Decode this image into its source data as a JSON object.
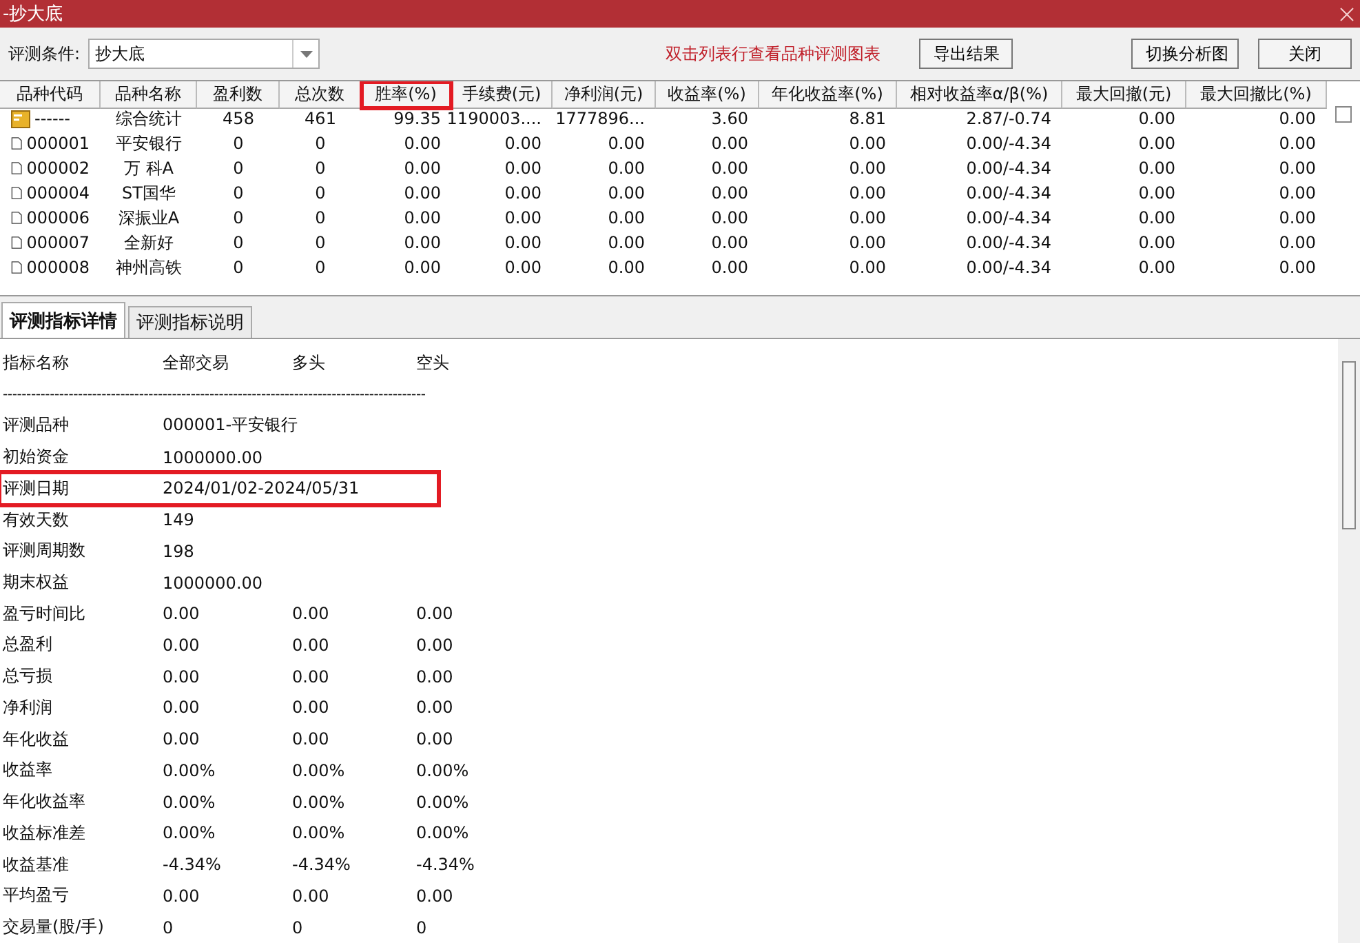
{
  "window": {
    "title": "-抄大底"
  },
  "toolbar": {
    "condition_label": "评测条件:",
    "condition_value": "抄大底",
    "hint": "双击列表行查看品种评测图表",
    "buttons": [
      {
        "label": "导出结果"
      },
      {
        "label": "切换分析图"
      },
      {
        "label": "关闭"
      }
    ]
  },
  "table": {
    "select_all_checked": false,
    "columns": [
      {
        "label": "品种代码",
        "highlighted": false
      },
      {
        "label": "品种名称",
        "highlighted": false
      },
      {
        "label": "盈利数",
        "highlighted": false
      },
      {
        "label": "总次数",
        "highlighted": false
      },
      {
        "label": "胜率(%)",
        "highlighted": true
      },
      {
        "label": "手续费(元)",
        "highlighted": false
      },
      {
        "label": "净利润(元)",
        "highlighted": false
      },
      {
        "label": "收益率(%)",
        "highlighted": false
      },
      {
        "label": "年化收益率(%)",
        "highlighted": false
      },
      {
        "label": "相对收益率α/β(%)",
        "highlighted": false
      },
      {
        "label": "最大回撤(元)",
        "highlighted": false
      },
      {
        "label": "最大回撤比(%)",
        "highlighted": false
      }
    ],
    "rows": [
      {
        "kind": "summary",
        "cells": [
          "------",
          "综合统计",
          "458",
          "461",
          "99.35",
          "1190003....",
          "1777896...",
          "3.60",
          "8.81",
          "2.87/-0.74",
          "0.00",
          "0.00"
        ]
      },
      {
        "kind": "stock",
        "cells": [
          "000001",
          "平安银行",
          "0",
          "0",
          "0.00",
          "0.00",
          "0.00",
          "0.00",
          "0.00",
          "0.00/-4.34",
          "0.00",
          "0.00"
        ]
      },
      {
        "kind": "stock",
        "cells": [
          "000002",
          "万 科A",
          "0",
          "0",
          "0.00",
          "0.00",
          "0.00",
          "0.00",
          "0.00",
          "0.00/-4.34",
          "0.00",
          "0.00"
        ]
      },
      {
        "kind": "stock",
        "cells": [
          "000004",
          "ST国华",
          "0",
          "0",
          "0.00",
          "0.00",
          "0.00",
          "0.00",
          "0.00",
          "0.00/-4.34",
          "0.00",
          "0.00"
        ]
      },
      {
        "kind": "stock",
        "cells": [
          "000006",
          "深振业A",
          "0",
          "0",
          "0.00",
          "0.00",
          "0.00",
          "0.00",
          "0.00",
          "0.00/-4.34",
          "0.00",
          "0.00"
        ]
      },
      {
        "kind": "stock",
        "cells": [
          "000007",
          "全新好",
          "0",
          "0",
          "0.00",
          "0.00",
          "0.00",
          "0.00",
          "0.00",
          "0.00/-4.34",
          "0.00",
          "0.00"
        ]
      },
      {
        "kind": "stock",
        "cells": [
          "000008",
          "神州高铁",
          "0",
          "0",
          "0.00",
          "0.00",
          "0.00",
          "0.00",
          "0.00",
          "0.00/-4.34",
          "0.00",
          "0.00"
        ]
      }
    ]
  },
  "tabs": [
    {
      "label": "评测指标详情",
      "selected": true
    },
    {
      "label": "评测指标说明",
      "selected": false
    }
  ],
  "details": {
    "headers": [
      "指标名称",
      "全部交易",
      "多头",
      "空头"
    ],
    "separator": "------------------------------------------------------------------------------------------",
    "rows": [
      {
        "label": "评测品种",
        "values": [
          "000001-平安银行"
        ],
        "highlighted": false
      },
      {
        "label": "初始资金",
        "values": [
          "1000000.00"
        ],
        "highlighted": false
      },
      {
        "label": "评测日期",
        "values": [
          "2024/01/02-2024/05/31"
        ],
        "highlighted": true
      },
      {
        "label": "有效天数",
        "values": [
          "149"
        ],
        "highlighted": false
      },
      {
        "label": "评测周期数",
        "values": [
          "198"
        ],
        "highlighted": false
      },
      {
        "label": "期末权益",
        "values": [
          "1000000.00"
        ],
        "highlighted": false
      },
      {
        "label": "盈亏时间比",
        "values": [
          "0.00",
          "0.00",
          "0.00"
        ],
        "highlighted": false
      },
      {
        "label": "总盈利",
        "values": [
          "0.00",
          "0.00",
          "0.00"
        ],
        "highlighted": false
      },
      {
        "label": "总亏损",
        "values": [
          "0.00",
          "0.00",
          "0.00"
        ],
        "highlighted": false
      },
      {
        "label": "净利润",
        "values": [
          "0.00",
          "0.00",
          "0.00"
        ],
        "highlighted": false
      },
      {
        "label": "年化收益",
        "values": [
          "0.00",
          "0.00",
          "0.00"
        ],
        "highlighted": false
      },
      {
        "label": "收益率",
        "values": [
          "0.00%",
          "0.00%",
          "0.00%"
        ],
        "highlighted": false
      },
      {
        "label": "年化收益率",
        "values": [
          "0.00%",
          "0.00%",
          "0.00%"
        ],
        "highlighted": false
      },
      {
        "label": "收益标准差",
        "values": [
          "0.00%",
          "0.00%",
          "0.00%"
        ],
        "highlighted": false
      },
      {
        "label": "收益基准",
        "values": [
          "-4.34%",
          "-4.34%",
          "-4.34%"
        ],
        "highlighted": false
      },
      {
        "label": "平均盈亏",
        "values": [
          "0.00",
          "0.00",
          "0.00"
        ],
        "highlighted": false
      },
      {
        "label": "交易量(股/手)",
        "values": [
          "0",
          "0",
          "0"
        ],
        "highlighted": false
      }
    ]
  }
}
